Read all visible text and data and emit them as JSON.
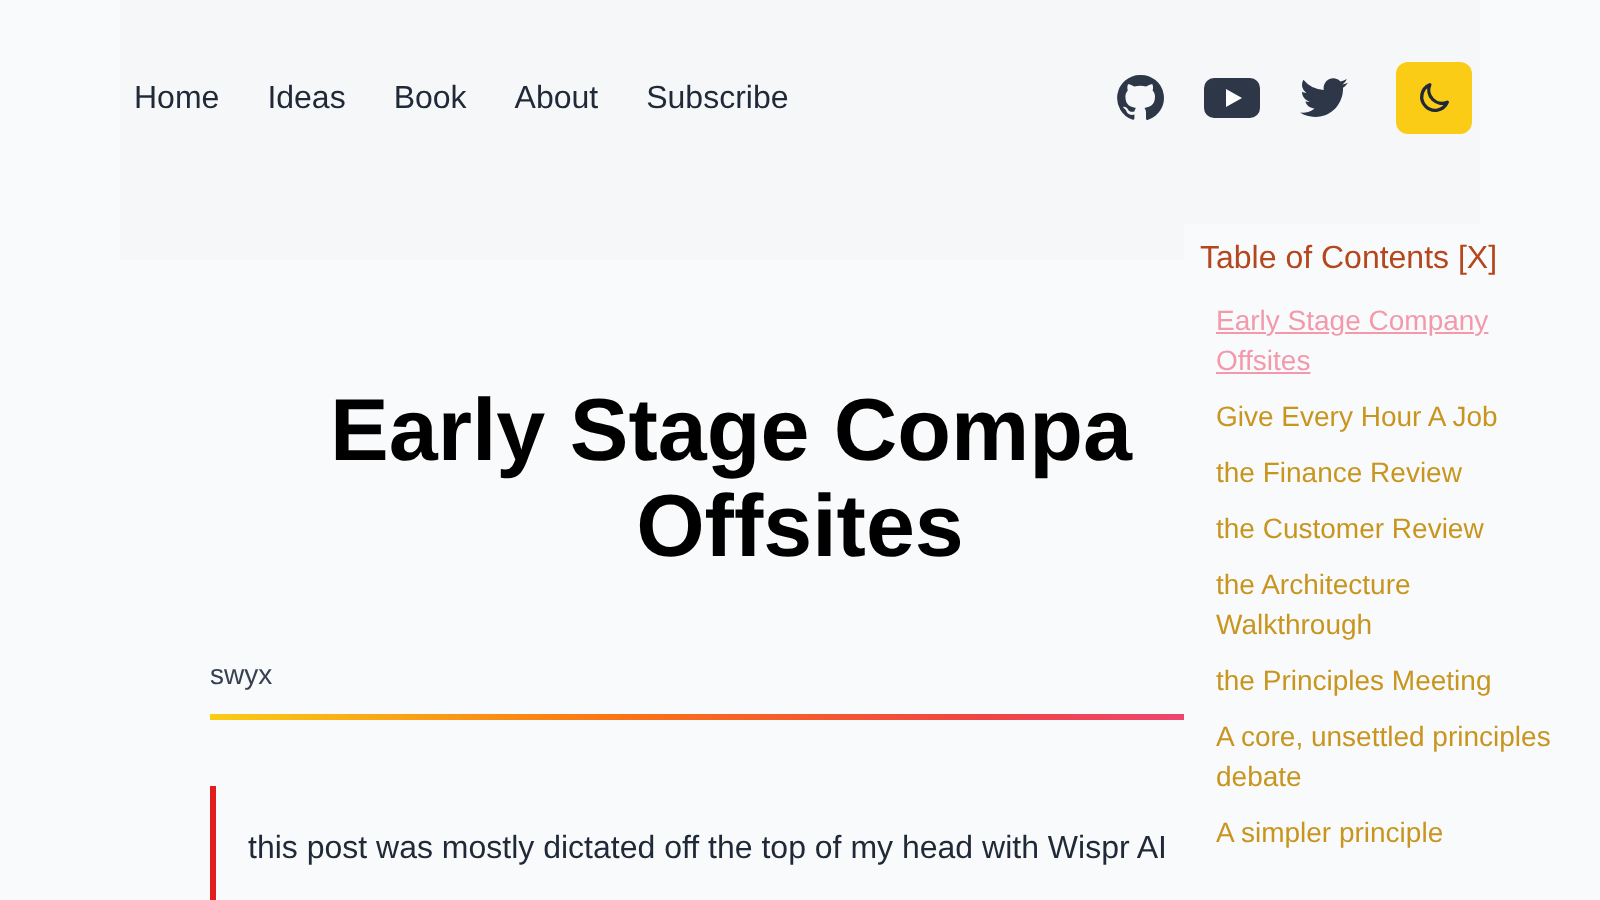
{
  "nav": {
    "links": [
      "Home",
      "Ideas",
      "Book",
      "About",
      "Subscribe"
    ],
    "icons": [
      {
        "kind": "github"
      },
      {
        "kind": "youtube"
      },
      {
        "kind": "twitter"
      }
    ],
    "theme_toggle": {
      "kind": "moon"
    }
  },
  "article": {
    "title_lines": [
      "Early Stage Compa",
      "Offsites"
    ],
    "author": "swyx",
    "quote": "this post was mostly dictated off the top of my head with Wispr AI"
  },
  "toc": {
    "title": "Table of Contents [X]",
    "items": [
      {
        "label": "Early Stage Company Offsites",
        "selected": true
      },
      {
        "label": "Give Every Hour A Job",
        "selected": false
      },
      {
        "label": "the Finance Review",
        "selected": false
      },
      {
        "label": "the Customer Review",
        "selected": false
      },
      {
        "label": "the Architecture Walkthrough",
        "selected": false
      },
      {
        "label": "the Principles Meeting",
        "selected": false
      },
      {
        "label": "A core, unsettled principles debate",
        "selected": false
      },
      {
        "label": "A simpler principle",
        "selected": false
      }
    ]
  }
}
